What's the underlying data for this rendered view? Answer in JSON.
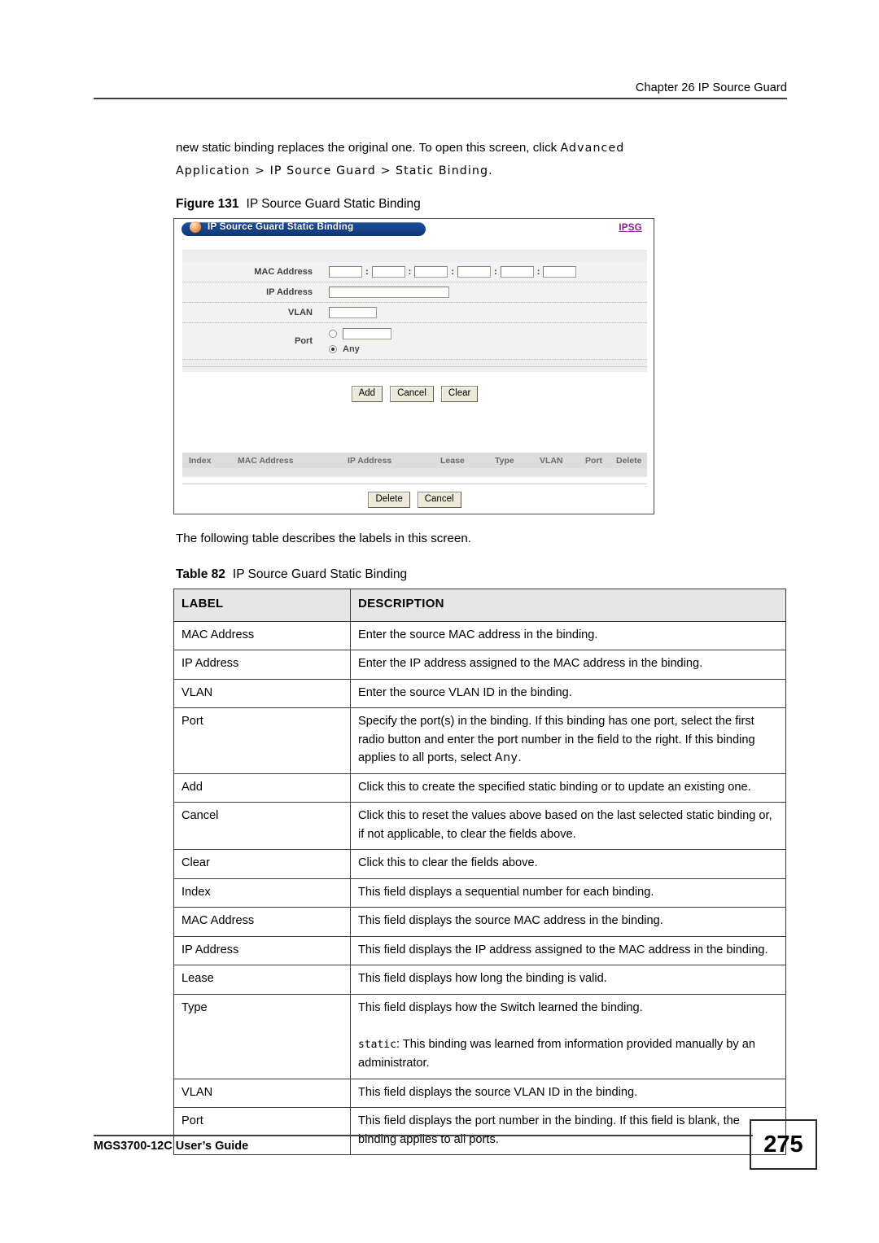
{
  "header": {
    "chapter": "Chapter 26 IP Source Guard"
  },
  "intro": {
    "line1": "new static binding replaces the original one. To open this screen, click ",
    "path1": "Advanced",
    "path2": "Application > IP Source Guard > Static Binding",
    "period": "."
  },
  "figure": {
    "number": "Figure 131",
    "title": "IP Source Guard Static Binding"
  },
  "screenshot": {
    "panel_title": "IP Source Guard Static Binding",
    "ipsg_link": "IPSG",
    "labels": {
      "mac_address": "MAC Address",
      "ip_address": "IP Address",
      "vlan": "VLAN",
      "port": "Port"
    },
    "fields": {
      "mac_1": "",
      "mac_2": "",
      "mac_3": "",
      "mac_4": "",
      "mac_5": "",
      "mac_6": "",
      "mac_separator": ":",
      "ip": "",
      "vlan": "",
      "port_number": ""
    },
    "port_options": {
      "specific_selected": false,
      "any_label": "Any",
      "any_selected": true
    },
    "buttons": {
      "add": "Add",
      "cancel": "Cancel",
      "clear": "Clear",
      "delete": "Delete",
      "cancel2": "Cancel"
    },
    "list_columns": [
      "Index",
      "MAC Address",
      "IP Address",
      "Lease",
      "Type",
      "VLAN",
      "Port",
      "Delete"
    ],
    "colors": {
      "titlebar_blue": "#17458c",
      "orb_orange": "#e8843a",
      "ipsg_purple": "#8e1a8e",
      "panel_gray": "#f0f0f0",
      "button_face": "#ece9d8"
    }
  },
  "follow_text": "The following table describes the labels in this screen.",
  "table": {
    "number": "Table 82",
    "title": "IP Source Guard Static Binding",
    "headers": [
      "LABEL",
      "DESCRIPTION"
    ],
    "rows": [
      {
        "label": "MAC Address",
        "description": "Enter the source MAC address in the binding."
      },
      {
        "label": "IP Address",
        "description": "Enter the IP address assigned to the MAC address in the binding."
      },
      {
        "label": "VLAN",
        "description": "Enter the source VLAN ID in the binding."
      },
      {
        "label": "Port",
        "description": "Specify the port(s) in the binding. If this binding has one port, select the first radio button and enter the port number in the field to the right. If this binding applies to all ports, select Any."
      },
      {
        "label": "Add",
        "description": "Click this to create the specified static binding or to update an existing one."
      },
      {
        "label": "Cancel",
        "description": "Click this to reset the values above based on the last selected static binding or, if not applicable, to clear the fields above."
      },
      {
        "label": "Clear",
        "description": "Click this to clear the fields above."
      },
      {
        "label": "Index",
        "description": "This field displays a sequential number for each binding."
      },
      {
        "label": "MAC Address",
        "description": "This field displays the source MAC address in the binding."
      },
      {
        "label": "IP Address",
        "description": "This field displays the IP address assigned to the MAC address in the binding."
      },
      {
        "label": "Lease",
        "description": "This field displays how long the binding is valid."
      },
      {
        "label": "Type",
        "description": "This field displays how the Switch learned the binding."
      },
      {
        "label": "VLAN",
        "description": "This field displays the source VLAN ID in the binding."
      },
      {
        "label": "Port",
        "description": "This field displays the port number in the binding. If this field is blank, the binding applies to all ports."
      }
    ],
    "port_desc_part1": "Specify the port(s) in the binding. If this binding has one port, select the first radio button and enter the port number in the field to the right. If this binding applies to all ports, select ",
    "port_desc_any": "Any",
    "port_desc_end": ".",
    "type_desc_line1": "This field displays how the Switch learned the binding.",
    "type_desc_code": "static",
    "type_desc_line2": ": This binding was learned from information provided manually by an administrator."
  },
  "footer": {
    "guide": "MGS3700-12C User’s Guide",
    "page_number": "275"
  }
}
